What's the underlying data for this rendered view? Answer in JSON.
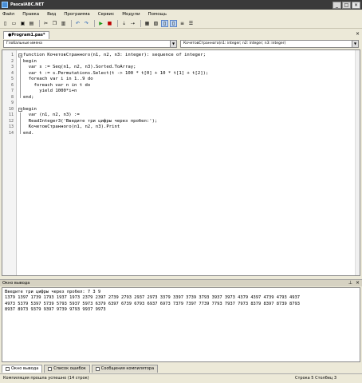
{
  "window": {
    "title": "PascalABC.NET"
  },
  "menu": [
    "Файл",
    "Правка",
    "Вид",
    "Программа",
    "Сервис",
    "Модули",
    "Помощь"
  ],
  "tabs": [
    {
      "label": "●Program1.pas*"
    }
  ],
  "nav": {
    "left": "Глобальные имена",
    "right": "КочетовСтранного(n1: integer; n2: integer; n3: integer)"
  },
  "editor": {
    "line_numbers": [
      "1",
      "2",
      "3",
      "4",
      "5",
      "6",
      "7",
      "8",
      "9",
      "10",
      "11",
      "12",
      "13",
      "14"
    ],
    "lines": [
      "function КочетовСтранного(n1, n2, n3: integer): sequence of integer;",
      "begin",
      "  var s := Seq(n1, n2, n3).Sorted.ToArray;",
      "  var t := s.Permutations.Select(t -> 100 * t[0] + 10 * t[1] + t[2]);",
      "  foreach var i in 1..9 do",
      "    foreach var n in t do",
      "      yield 1000*i+n",
      "end;",
      "",
      "begin",
      "  var (n1, n2, n3) :=",
      "  ReadInteger3('Введите три цифры через пробел:');",
      "  КочетовСтранного(n1, n2, n3).Print",
      "end."
    ]
  },
  "output_panel": {
    "title": "Окно вывода",
    "lines": [
      "Введите три цифры через пробел: 7 3 9",
      "1379 1397 1739 1793 1937 1973 2379 2397 2739 2793 2937 2973 3379 3397 3739 3793 3937 3973 4379 4397 4739 4793 4937",
      "4973 5379 5397 5739 5793 5937 5973 6379 6397 6739 6793 6937 6973 7379 7397 7739 7793 7937 7973 8379 8397 8739 8793",
      "8937 8973 9379 9397 9739 9793 9937 9973"
    ]
  },
  "bottom_tabs": [
    "Окно вывода",
    "Список ошибок",
    "Сообщения компилятора"
  ],
  "status": {
    "message": "Компиляция прошла успешно (14 строк)",
    "position": "Строка 5 Столбец 3"
  }
}
